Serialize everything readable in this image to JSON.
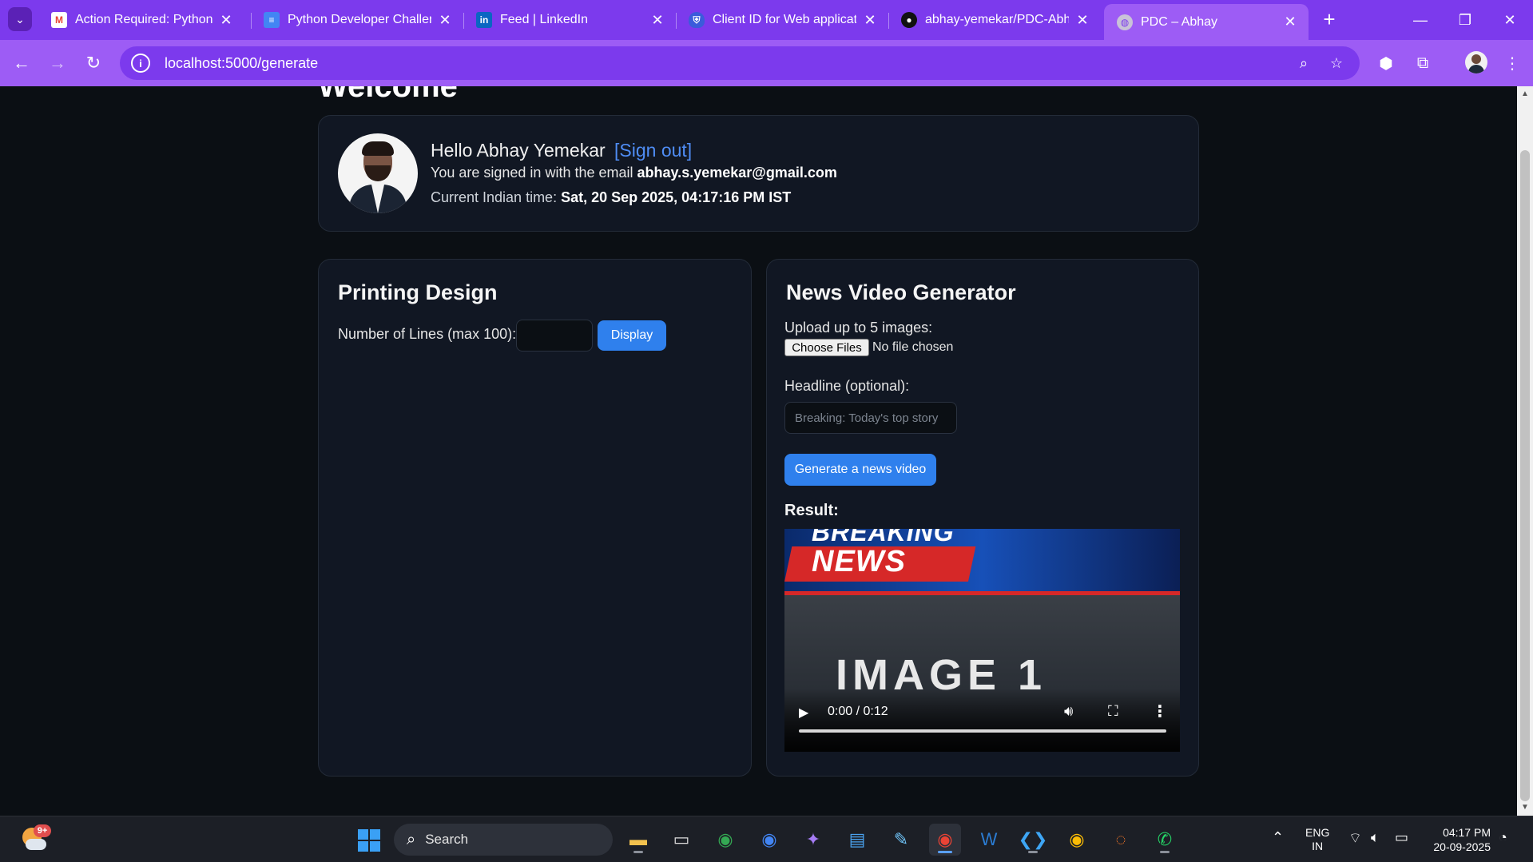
{
  "browser": {
    "tabs": [
      {
        "title": "Action Required: Python D",
        "favicon": "gmail-icon"
      },
      {
        "title": "Python Developer Challeng",
        "favicon": "docs-icon"
      },
      {
        "title": "Feed | LinkedIn",
        "favicon": "linkedin-icon"
      },
      {
        "title": "Client ID for Web applicati",
        "favicon": "shield-icon"
      },
      {
        "title": "abhay-yemekar/PDC-Abha",
        "favicon": "github-icon"
      },
      {
        "title": "PDC – Abhay",
        "favicon": "globe-icon",
        "active": true
      }
    ],
    "url": "localhost:5000/generate",
    "theme_color": "#7c3aed"
  },
  "page": {
    "welcome_heading": "Welcome",
    "profile": {
      "hello": "Hello Abhay Yemekar",
      "sign_out": "[Sign out]",
      "signed_in_prefix": "You are signed in with the email ",
      "email": "abhay.s.yemekar@gmail.com",
      "time_prefix": "Current Indian time: ",
      "time_value": "Sat, 20 Sep 2025, 04:17:16 PM IST"
    },
    "printing": {
      "title": "Printing Design",
      "lines_label": "Number of Lines (max 100):",
      "lines_value": "",
      "display_button": "Display"
    },
    "news": {
      "title": "News Video Generator",
      "upload_label": "Upload up to 5 images:",
      "choose_files": "Choose Files",
      "no_file": "No file chosen",
      "headline_label": "Headline (optional):",
      "headline_placeholder": "Breaking: Today's top story",
      "generate_button": "Generate a news video",
      "result_label": "Result:",
      "video": {
        "breaking_text": "BREAKING",
        "news_text": "NEWS",
        "frame_text": "IMAGE 1",
        "time": "0:00 / 0:12"
      }
    },
    "accent_color": "#2f80ed"
  },
  "taskbar": {
    "weather_badge": "9+",
    "search_label": "Search",
    "apps": [
      "file-explorer-icon",
      "terminal-icon",
      "chrome-icon",
      "chrome-alt-icon",
      "copilot-icon",
      "notepad-icon",
      "paint-icon",
      "chrome-active-icon",
      "word-icon",
      "vscode-icon",
      "chrome-canary-icon",
      "jupyter-icon",
      "whatsapp-icon"
    ],
    "lang_top": "ENG",
    "lang_bottom": "IN",
    "time": "04:17 PM",
    "date": "20-09-2025"
  }
}
